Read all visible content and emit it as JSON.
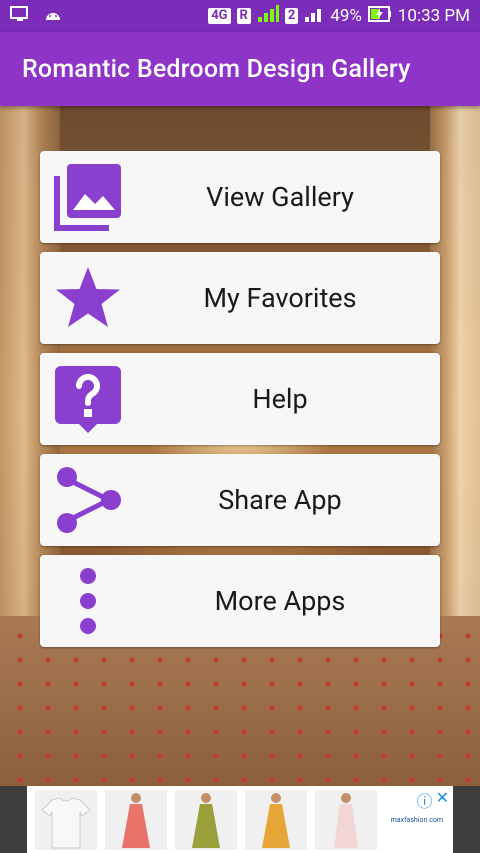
{
  "status_bar": {
    "network_type": "4G",
    "roaming": "R",
    "sim2": "2",
    "battery": "49%",
    "time": "10:33 PM"
  },
  "app_bar": {
    "title": "Romantic Bedroom Design Gallery"
  },
  "menu": {
    "items": [
      {
        "label": "View Gallery",
        "icon": "photo-library-icon"
      },
      {
        "label": "My Favorites",
        "icon": "star-icon"
      },
      {
        "label": "Help",
        "icon": "help-bubble-icon"
      },
      {
        "label": "Share App",
        "icon": "share-icon"
      },
      {
        "label": "More Apps",
        "icon": "more-vert-icon"
      }
    ]
  },
  "ad": {
    "brand": "maxfashion.com"
  },
  "colors": {
    "primary": "#8E35C7",
    "primary_dark": "#7B2CB8",
    "icon_purple": "#8A3FCF",
    "card": "#F7F7F7"
  }
}
